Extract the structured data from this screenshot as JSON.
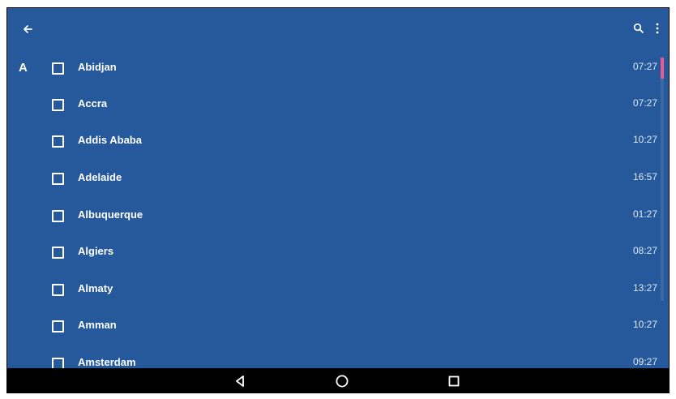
{
  "icons": {
    "back": "arrow-left-icon",
    "search": "search-icon",
    "menu": "more-vertical-icon",
    "nav_back": "triangle-back-icon",
    "nav_home": "circle-home-icon",
    "nav_recent": "square-recents-icon"
  },
  "colors": {
    "background": "#26589c",
    "accent": "#ea5a8c",
    "text": "#ffffff"
  },
  "list": {
    "section_letter": "A",
    "rows": [
      {
        "city": "Abidjan",
        "time": "07:27"
      },
      {
        "city": "Accra",
        "time": "07:27"
      },
      {
        "city": "Addis Ababa",
        "time": "10:27"
      },
      {
        "city": "Adelaide",
        "time": "16:57"
      },
      {
        "city": "Albuquerque",
        "time": "01:27"
      },
      {
        "city": "Algiers",
        "time": "08:27"
      },
      {
        "city": "Almaty",
        "time": "13:27"
      },
      {
        "city": "Amman",
        "time": "10:27"
      },
      {
        "city": "Amsterdam",
        "time": "09:27"
      }
    ]
  }
}
